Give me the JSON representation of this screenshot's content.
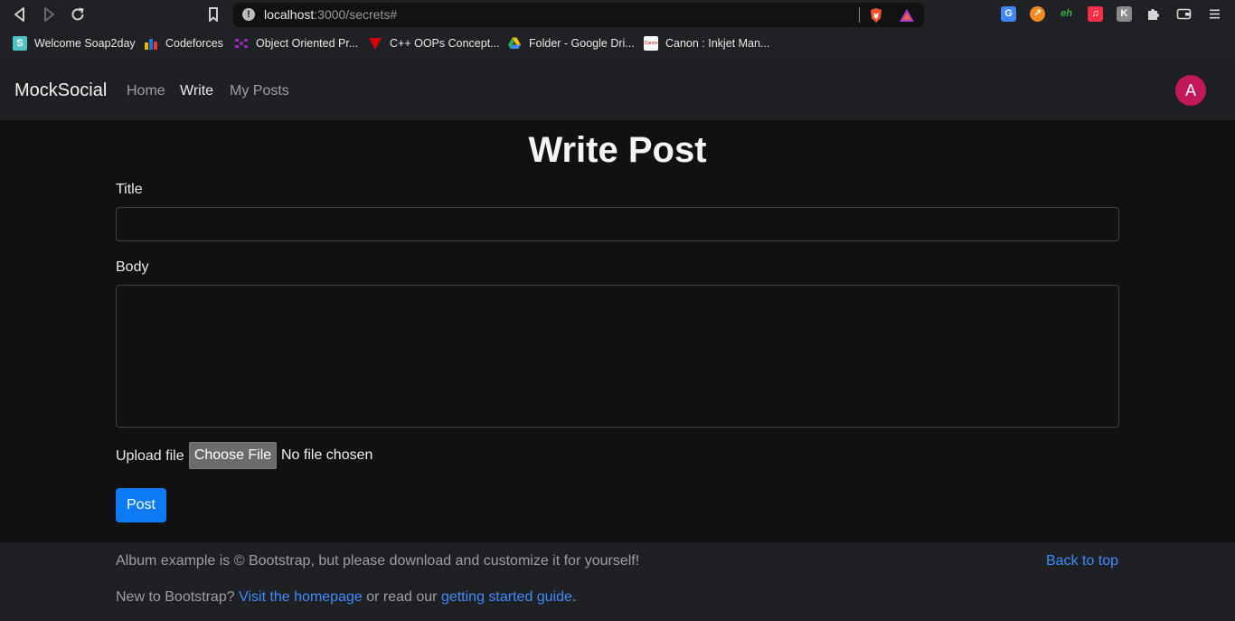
{
  "browser": {
    "url_host": "localhost",
    "url_rest": ":3000/secrets#",
    "bookmarks": [
      {
        "label": "Welcome Soap2day",
        "color": "#4fc3c4"
      },
      {
        "label": "Codeforces",
        "color": "#f4b400"
      },
      {
        "label": "Object Oriented Pr...",
        "color": "#9c27b0"
      },
      {
        "label": "C++ OOPs Concept...",
        "color": "#d50000"
      },
      {
        "label": "Folder - Google Dri...",
        "color": "#34a853"
      },
      {
        "label": "Canon : Inkjet Man...",
        "color": "#ffffff"
      }
    ]
  },
  "navbar": {
    "brand": "MockSocial",
    "links": [
      "Home",
      "Write",
      "My Posts"
    ],
    "active": "Write",
    "avatar_letter": "A",
    "avatar_color": "#c2185b"
  },
  "form": {
    "heading": "Write Post",
    "title_label": "Title",
    "title_value": "",
    "body_label": "Body",
    "body_value": "",
    "upload_label": "Upload file",
    "choose_file": "Choose File",
    "no_file": "No file chosen",
    "submit": "Post"
  },
  "footer": {
    "copyright": "Album example is © Bootstrap, but please download and customize it for yourself!",
    "back_to_top": "Back to top",
    "new_to": "New to Bootstrap?",
    "homepage_link": "Visit the homepage",
    "or_read": "or read our",
    "guide_link": "getting started guide",
    "period": "."
  },
  "colors": {
    "accent": "#0d7bf6",
    "link": "#3d8bfd"
  }
}
